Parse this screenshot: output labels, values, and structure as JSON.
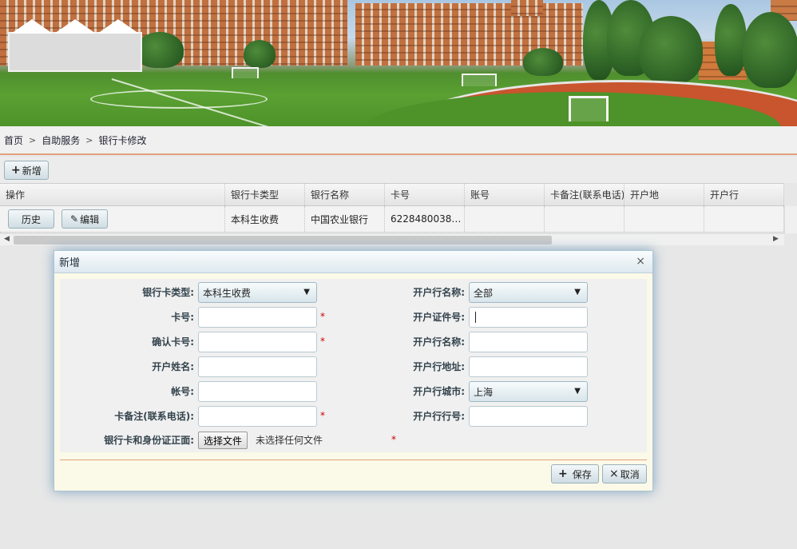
{
  "breadcrumb": {
    "items": [
      "首页",
      "自助服务",
      "银行卡修改"
    ],
    "separator": ">"
  },
  "toolbar": {
    "add_label": "新增"
  },
  "grid": {
    "columns": [
      "操作",
      "银行卡类型",
      "银行名称",
      "卡号",
      "账号",
      "卡备注(联系电话)",
      "开户地",
      "开户行"
    ],
    "rows": [
      {
        "history_label": "历史",
        "edit_label": "编辑",
        "card_type": "本科生收费",
        "bank_name": "中国农业银行",
        "card_no": "62284800381...",
        "account": "",
        "remark": "",
        "location": "",
        "branch": ""
      }
    ]
  },
  "dialog": {
    "title": "新增",
    "close_icon": "×",
    "left_fields": [
      {
        "label": "银行卡类型:",
        "type": "select",
        "value": "本科生收费",
        "required": false
      },
      {
        "label": "卡号:",
        "type": "input",
        "value": "",
        "required": true
      },
      {
        "label": "确认卡号:",
        "type": "input",
        "value": "",
        "required": true
      },
      {
        "label": "开户姓名:",
        "type": "input",
        "value": "",
        "required": false
      },
      {
        "label": "帐号:",
        "type": "input",
        "value": "",
        "required": false
      },
      {
        "label": "卡备注(联系电话):",
        "type": "input",
        "value": "",
        "required": true
      }
    ],
    "right_fields": [
      {
        "label": "开户行名称:",
        "type": "select",
        "value": "全部"
      },
      {
        "label": "开户证件号:",
        "type": "input",
        "value": ""
      },
      {
        "label": "开户行名称:",
        "type": "input",
        "value": ""
      },
      {
        "label": "开户行地址:",
        "type": "input",
        "value": ""
      },
      {
        "label": "开户行城市:",
        "type": "select",
        "value": "上海"
      },
      {
        "label": "开户行行号:",
        "type": "input",
        "value": ""
      }
    ],
    "file_field": {
      "label": "银行卡和身份证正面:",
      "button": "选择文件",
      "status": "未选择任何文件",
      "required": true
    },
    "required_mark": "*",
    "save_label": "保存",
    "cancel_label": "取消"
  },
  "icons": {
    "plus": "+",
    "pencil": "✎",
    "close": "×",
    "dropdown": "▼",
    "chevron": ">"
  },
  "colors": {
    "accent_line": "#e0a37a",
    "required": "#cc0000",
    "dialog_bg": "#fbf9e8"
  }
}
